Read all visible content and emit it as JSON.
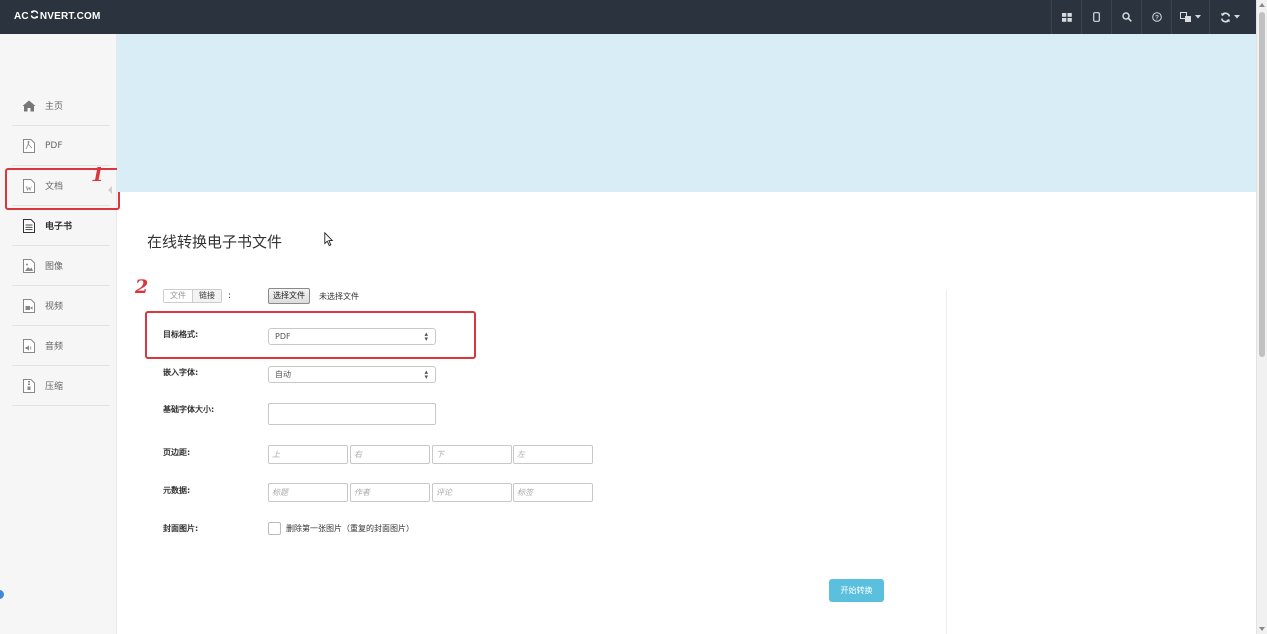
{
  "topbar": {
    "logo_prefix": "AC",
    "logo_suffix": "NVERT.COM",
    "buttons": [
      {
        "icon": "grid-icon"
      },
      {
        "icon": "mobile-icon"
      },
      {
        "icon": "search-icon"
      },
      {
        "icon": "help-icon"
      },
      {
        "icon": "language-icon"
      },
      {
        "icon": "refresh-icon"
      }
    ]
  },
  "sidebar": {
    "items": [
      {
        "label": "主页",
        "icon": "home-icon"
      },
      {
        "label": "PDF",
        "icon": "pdf-file-icon"
      },
      {
        "label": "文档",
        "icon": "word-file-icon"
      },
      {
        "label": "电子书",
        "icon": "ebook-file-icon"
      },
      {
        "label": "图像",
        "icon": "image-file-icon"
      },
      {
        "label": "视频",
        "icon": "video-file-icon"
      },
      {
        "label": "音频",
        "icon": "audio-file-icon"
      },
      {
        "label": "压缩",
        "icon": "archive-file-icon"
      }
    ],
    "active_index": 3
  },
  "annotations": {
    "one": "1",
    "two": "2"
  },
  "main": {
    "title": "在线转换电子书文件",
    "source_tabs": {
      "file": "文件",
      "link": "链接",
      "colon": ":"
    },
    "file_button": "选择文件",
    "file_status": "未选择文件",
    "target_format": {
      "label": "目标格式:",
      "value": "PDF"
    },
    "embed_font": {
      "label": "嵌入字体:",
      "value": "自动"
    },
    "base_font_size": {
      "label": "基础字体大小:",
      "value": ""
    },
    "margins": {
      "label": "页边距:",
      "top": "上",
      "right": "右",
      "bottom": "下",
      "left": "左"
    },
    "metadata": {
      "label": "元数据:",
      "title": "标题",
      "author": "作者",
      "comment": "评论",
      "tags": "标签"
    },
    "cover": {
      "label": "封面图片:",
      "checkbox_label": "删除第一张图片（重复的封面图片）",
      "checked": false
    },
    "start_button": "开始转换"
  },
  "colors": {
    "topbar_bg": "#2b333e",
    "banner_bg": "#d9edf7",
    "annotation_red": "#d9363e",
    "start_button_bg": "#5bc0de"
  }
}
